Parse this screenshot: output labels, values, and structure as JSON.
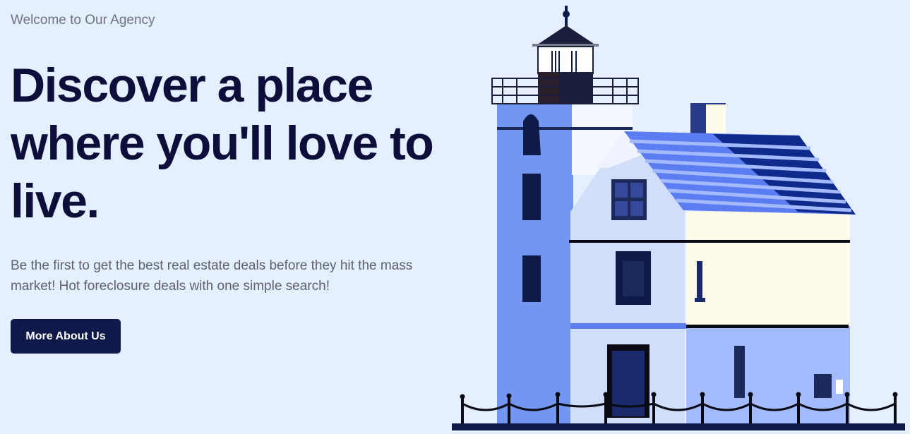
{
  "hero": {
    "eyebrow": "Welcome to Our Agency",
    "headline": "Discover a place where you'll love to live.",
    "subtitle": "Be the first to get the best real estate deals before they hit the mass market! Hot foreclosure deals with one simple search!",
    "cta_label": "More About Us"
  },
  "colors": {
    "background": "#e6efff",
    "heading": "#0b0f3a",
    "button_bg": "#101a4a",
    "button_text": "#ffffff",
    "tower_blue": "#7396f0",
    "roof_blue": "#5c7cf2",
    "dark_navy": "#0e1b48",
    "cream": "#fffbea"
  },
  "illustration": {
    "icon": "lighthouse-house-illustration"
  }
}
